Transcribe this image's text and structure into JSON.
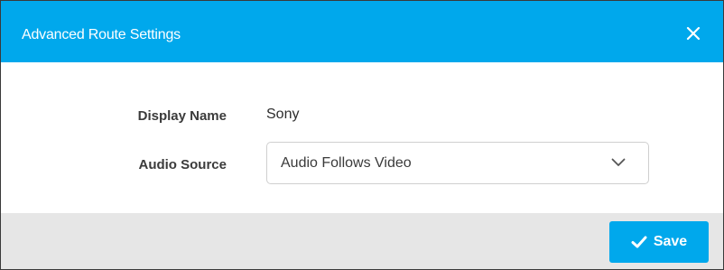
{
  "dialog": {
    "title": "Advanced Route Settings",
    "close_icon": "close-icon"
  },
  "form": {
    "display_name_label": "Display Name",
    "display_name_value": "Sony",
    "audio_source_label": "Audio Source",
    "audio_source_selected": "Audio Follows Video",
    "audio_source_icon": "chevron-down-icon"
  },
  "footer": {
    "save_label": "Save",
    "save_icon": "check-icon"
  },
  "colors": {
    "accent": "#00a8ec",
    "footer_bg": "#e6e6e6",
    "label_text": "#3b3b3b"
  }
}
